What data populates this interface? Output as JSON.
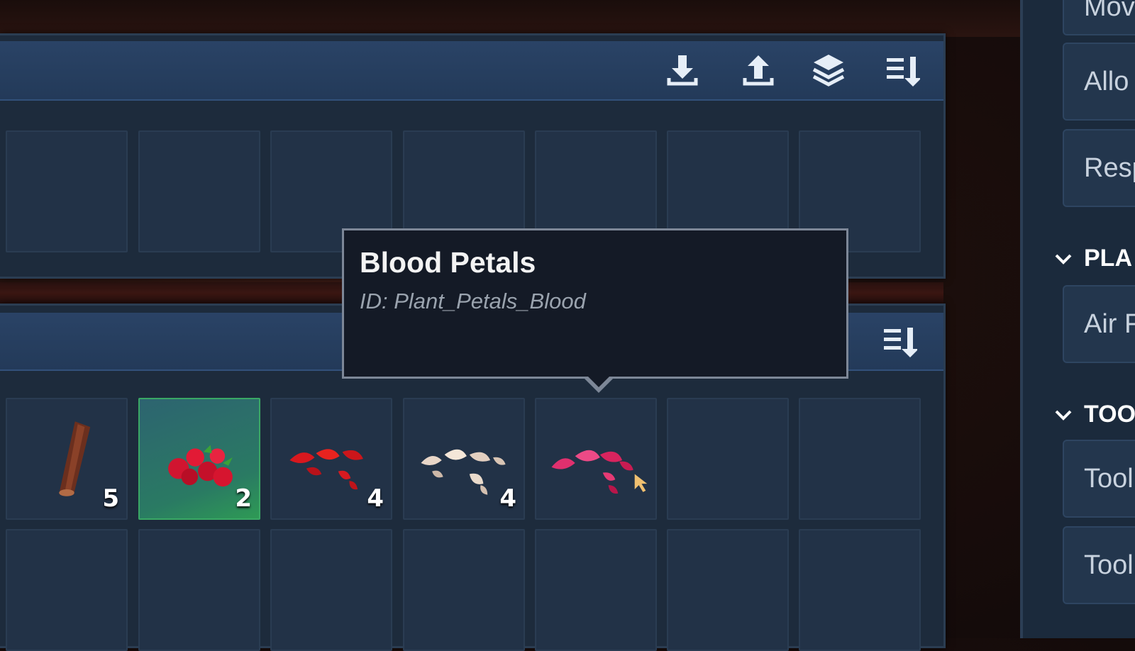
{
  "tooltip": {
    "title": "Blood Petals",
    "id_text": "ID: Plant_Petals_Blood"
  },
  "top_panel": {
    "icons": [
      "download-icon",
      "upload-icon",
      "layers-icon",
      "sort-icon"
    ]
  },
  "bottom_panel": {
    "icons": [
      "sort-icon"
    ],
    "slots": [
      {
        "item": "wood-stick-icon",
        "count": "5"
      },
      {
        "item": "red-berries-icon",
        "count": "2",
        "selected": true
      },
      {
        "item": "red-petals-icon",
        "count": "4"
      },
      {
        "item": "white-petals-icon",
        "count": "4"
      },
      {
        "item": "blood-petals-icon",
        "count": ""
      }
    ]
  },
  "sidebar": {
    "buttons_top": [
      "Mov",
      "Allo",
      "Resp"
    ],
    "section_1": {
      "label": "PLA",
      "buttons": [
        "Air F"
      ]
    },
    "section_2": {
      "label": "TOO",
      "buttons": [
        "Tool",
        "Tool"
      ]
    }
  },
  "colors": {
    "panel_bg": "#1d2b3c",
    "header_bg": "#2a4366",
    "selected_slot": "#2e9a55",
    "tooltip_bg": "#141a26"
  }
}
